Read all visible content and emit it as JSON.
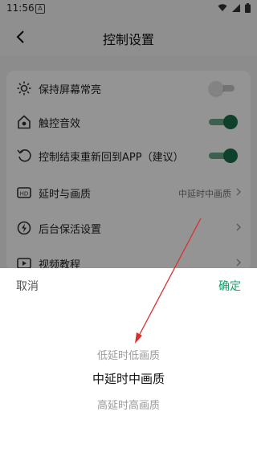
{
  "status": {
    "time": "11:56",
    "badge": "A"
  },
  "header": {
    "title": "控制设置"
  },
  "settings": [
    {
      "label": "保持屏幕常亮",
      "icon": "brightness-icon",
      "control": "toggle",
      "on": false
    },
    {
      "label": "触控音效",
      "icon": "home-sound-icon",
      "control": "toggle",
      "on": true
    },
    {
      "label": "控制结束重新回到APP（建议）",
      "icon": "return-icon",
      "control": "toggle",
      "on": true
    },
    {
      "label": "延时与画质",
      "icon": "hd-icon",
      "control": "value",
      "value": "中延时中画质"
    },
    {
      "label": "后台保活设置",
      "icon": "bolt-circle-icon",
      "control": "link"
    },
    {
      "label": "视频教程",
      "icon": "video-play-icon",
      "control": "link"
    }
  ],
  "sheet": {
    "cancel": "取消",
    "confirm": "确定",
    "options": [
      "低延时低画质",
      "中延时中画质",
      "高延时高画质"
    ],
    "selected_index": 1
  },
  "colors": {
    "accent": "#1aa06a",
    "toggle_on": "#1a6e4a",
    "annotation_arrow": "#d9302c"
  }
}
